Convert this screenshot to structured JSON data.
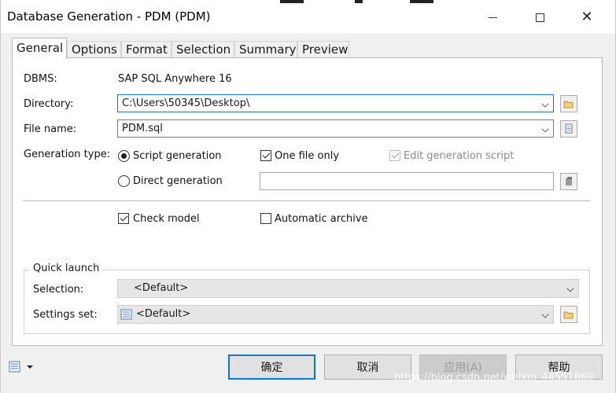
{
  "window": {
    "title": "Database Generation - PDM (PDM)"
  },
  "tabs": [
    {
      "label": "General",
      "active": true
    },
    {
      "label": "Options"
    },
    {
      "label": "Format"
    },
    {
      "label": "Selection"
    },
    {
      "label": "Summary"
    },
    {
      "label": "Preview"
    }
  ],
  "general": {
    "dbms_label": "DBMS:",
    "dbms_value": "SAP SQL Anywhere 16",
    "directory_label": "Directory:",
    "directory_value": "C:\\Users\\50345\\Desktop\\",
    "filename_label": "File name:",
    "filename_value": "PDM.sql",
    "gen_type_label": "Generation type:",
    "script_generation": "Script generation",
    "direct_generation": "Direct generation",
    "one_file_only": "One file only",
    "edit_generation_script": "Edit generation script",
    "check_model": "Check model",
    "automatic_archive": "Automatic archive"
  },
  "quick_launch": {
    "title": "Quick launch",
    "selection_label": "Selection:",
    "selection_value": "<Default>",
    "settings_label": "Settings set:",
    "settings_value": "<Default>"
  },
  "buttons": {
    "ok": "确定",
    "cancel": "取消",
    "apply": "应用(A)",
    "help": "帮助"
  },
  "watermark": "https://blog.csdn.net/weixin_44551869",
  "colors": {
    "accent": "#0078d7",
    "panel_bg": "#ffffff",
    "window_bg": "#f0f0f0"
  }
}
